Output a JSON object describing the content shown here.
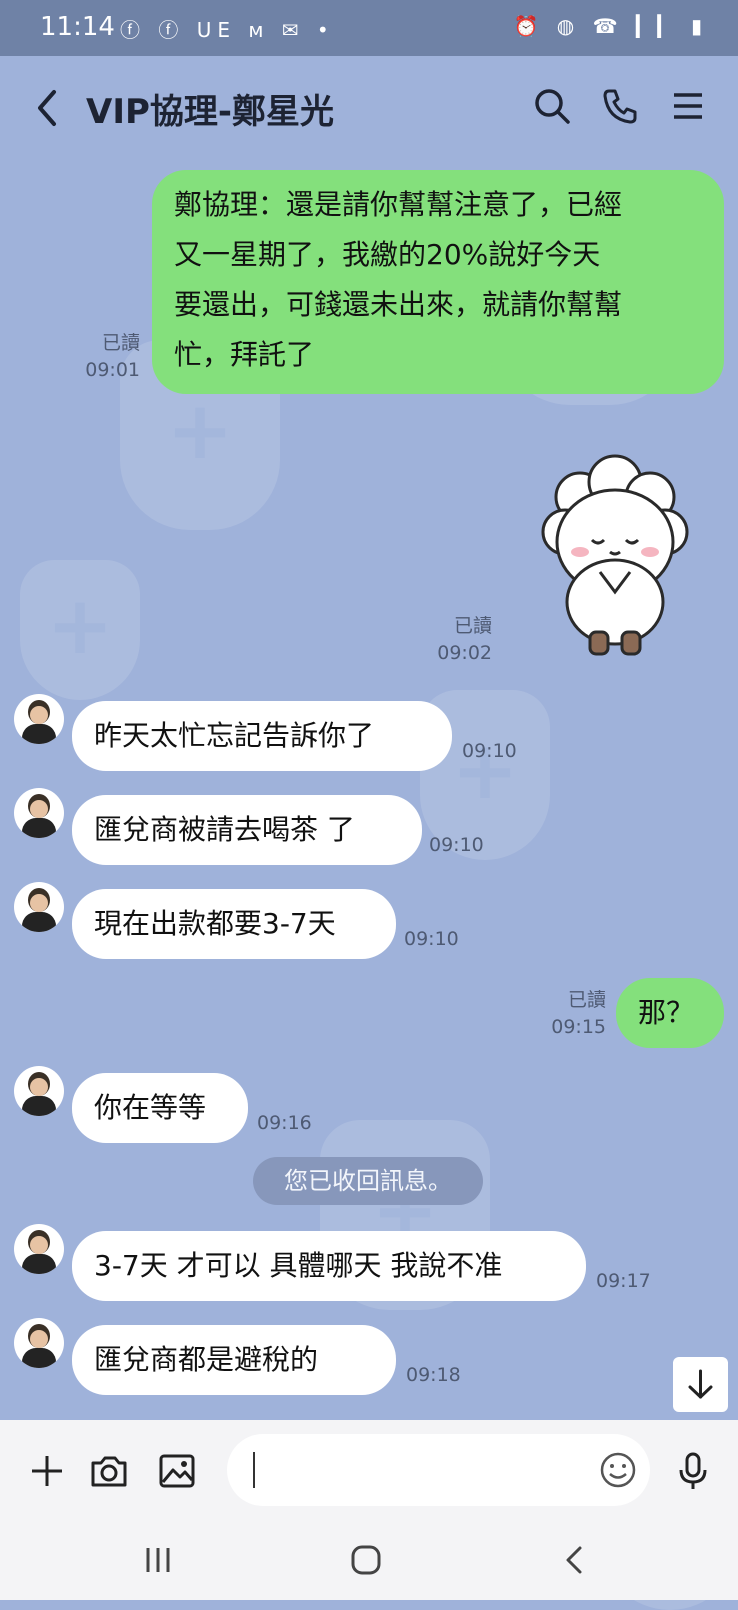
{
  "status_bar": {
    "time": "11:14",
    "left_icons": "ⓕ ⓕ UE ᴍ ✉ •",
    "right_icons": "⏰ ◍ ☎ ▎▎ ▮"
  },
  "header": {
    "title": "VIP協理-鄭星光",
    "icons": [
      "back-icon",
      "search-icon",
      "phone-icon",
      "menu-icon"
    ]
  },
  "messages": [
    {
      "dir": "out",
      "text_lines": [
        "鄭協理：還是請你幫幫注意了，已經",
        "又一星期了，我繳的20%說好今天",
        "要還出，可錢還未出來，就請你幫幫",
        "忙，拜託了"
      ],
      "read": "已讀",
      "time": "09:01"
    },
    {
      "dir": "out",
      "sticker": "sheep-sticker",
      "read": "已讀",
      "time": "09:02"
    },
    {
      "dir": "in",
      "text": "昨天太忙忘記告訴你了",
      "time": "09:10"
    },
    {
      "dir": "in",
      "text": "匯兌商被請去喝茶 了",
      "time": "09:10"
    },
    {
      "dir": "in",
      "text": "現在出款都要3-7天",
      "time": "09:10"
    },
    {
      "dir": "out",
      "text": "那？",
      "read": "已讀",
      "time": "09:15"
    },
    {
      "dir": "in",
      "text": "你在等等",
      "time": "09:16"
    },
    {
      "dir": "in",
      "text": "3-7天 才可以 具體哪天 我說不准",
      "time": "09:17"
    },
    {
      "dir": "in",
      "text": "匯兌商都是避稅的",
      "time": "09:18"
    }
  ],
  "system_notice": "您已收回訊息。",
  "composer": {
    "icons": [
      "plus-icon",
      "camera-icon",
      "image-icon",
      "emoji-icon",
      "mic-icon"
    ],
    "placeholder": ""
  },
  "colors": {
    "background": "#9fb2da",
    "outgoing_bubble": "#84e07c",
    "incoming_bubble": "#ffffff",
    "status_bar": "#6f82a6"
  }
}
